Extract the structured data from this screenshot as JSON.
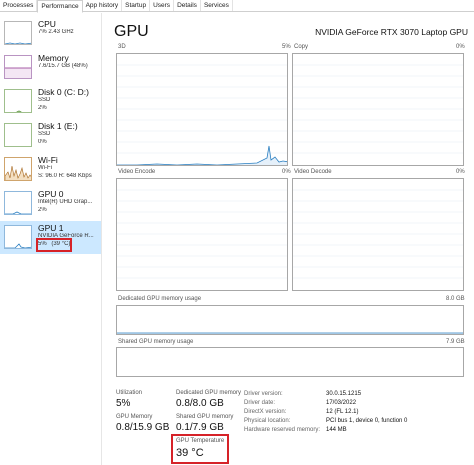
{
  "tabs": [
    "Processes",
    "Performance",
    "App history",
    "Startup",
    "Users",
    "Details",
    "Services"
  ],
  "sidebar": {
    "items": [
      {
        "name": "CPU",
        "sub1": "7% 2.43 GHz",
        "sub2": "",
        "sub3": ""
      },
      {
        "name": "Memory",
        "sub1": "7.6/15.7 GB (48%)",
        "sub2": "",
        "sub3": ""
      },
      {
        "name": "Disk 0 (C: D:)",
        "sub1": "SSD",
        "sub2": "2%",
        "sub3": ""
      },
      {
        "name": "Disk 1 (E:)",
        "sub1": "SSD",
        "sub2": "0%",
        "sub3": ""
      },
      {
        "name": "Wi-Fi",
        "sub1": "Wi-Fi",
        "sub2": "S: 96.0  R: 648 Kbps",
        "sub3": ""
      },
      {
        "name": "GPU 0",
        "sub1": "Intel(R) UHD Grap...",
        "sub2": "2%",
        "sub3": ""
      },
      {
        "name": "GPU 1",
        "sub1": "NVIDIA GeForce R...",
        "sub2": "5%",
        "sub3": "(39 °C)"
      }
    ]
  },
  "main": {
    "title": "GPU",
    "device": "NVIDIA GeForce RTX 3070 Laptop GPU",
    "graphs": {
      "g3d": {
        "label": "3D",
        "pct": "5%"
      },
      "copy": {
        "label": "Copy",
        "pct": "0%"
      },
      "encode": {
        "label": "Video Encode",
        "pct": "0%"
      },
      "decode": {
        "label": "Video Decode",
        "pct": "0%"
      },
      "dedicated": {
        "label": "Dedicated GPU memory usage",
        "max": "8.0 GB"
      },
      "shared": {
        "label": "Shared GPU memory usage",
        "max": "7.9 GB"
      }
    },
    "stats": {
      "utilization": {
        "label": "Utilization",
        "value": "5%"
      },
      "dedicated": {
        "label": "Dedicated GPU memory",
        "value": "0.8/8.0 GB"
      },
      "gpu_memory": {
        "label": "GPU Memory",
        "value": "0.8/15.9 GB"
      },
      "shared": {
        "label": "Shared GPU memory",
        "value": "0.1/7.9 GB"
      },
      "temperature": {
        "label": "GPU Temperature",
        "value": "39 °C"
      }
    },
    "details": [
      {
        "label": "Driver version:",
        "value": "30.0.15.1215"
      },
      {
        "label": "Driver date:",
        "value": "17/03/2022"
      },
      {
        "label": "DirectX version:",
        "value": "12 (FL 12.1)"
      },
      {
        "label": "Physical location:",
        "value": "PCI bus 1, device 0, function 0"
      },
      {
        "label": "Hardware reserved memory:",
        "value": "144 MB"
      }
    ]
  },
  "colors": {
    "gpu_line": "#2a7fc1",
    "memory_line": "#8b2d8b",
    "disk_line": "#4c8b2b",
    "wifi_line": "#a5651c",
    "selection": "#cce8ff",
    "highlight": "#d62228"
  }
}
